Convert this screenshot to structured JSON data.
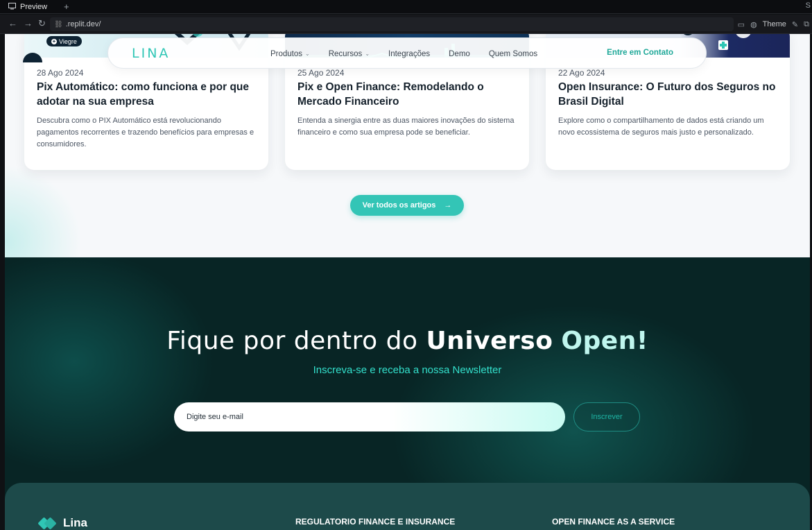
{
  "browser": {
    "tab_title": "Preview",
    "tab_add": "+",
    "url": ".replit.dev/",
    "theme_label": "Theme"
  },
  "nav": {
    "logo": "LINA",
    "links": [
      "Produtos",
      "Recursos",
      "Integrações",
      "Demo",
      "Quem Somos"
    ],
    "contact": "Entre em Contato"
  },
  "badge": "Viegre",
  "articles": [
    {
      "date": "28 Ago 2024",
      "title": "Pix Automático: como funciona e por que adotar na sua empresa",
      "description": "Descubra como o PIX Automático está revolucionando pagamentos recorrentes e trazendo benefícios para empresas e consumidores."
    },
    {
      "date": "25 Ago 2024",
      "title": "Pix e Open Finance: Remodelando o Mercado Financeiro",
      "description": "Entenda a sinergia entre as duas maiores inovações do sistema financeiro e como sua empresa pode se beneficiar."
    },
    {
      "date": "22 Ago 2024",
      "title": "Open Insurance: O Futuro dos Seguros no Brasil Digital",
      "description": "Explore como o compartilhamento de dados está criando um novo ecossistema de seguros mais justo e personalizado."
    }
  ],
  "cta": {
    "label": "Ver todos os artigos",
    "arrow": "→"
  },
  "newsletter": {
    "title_part1": "Fique por dentro do ",
    "title_bold": "Universo",
    "title_accent": "Open!",
    "subtitle": "Inscreva-se e receba a nossa Newsletter",
    "email_placeholder": "Digite seu e-mail",
    "subscribe_label": "Inscrever"
  },
  "footer": {
    "brand": "Lina",
    "col1_heading": "REGULATORIO FINANCE E INSURANCE",
    "col2_heading": "OPEN FINANCE AS A SERVICE"
  },
  "colors": {
    "accent": "#33c5b6",
    "newsletter_bg": "#082525",
    "footer_bg": "#1d4a4a"
  }
}
